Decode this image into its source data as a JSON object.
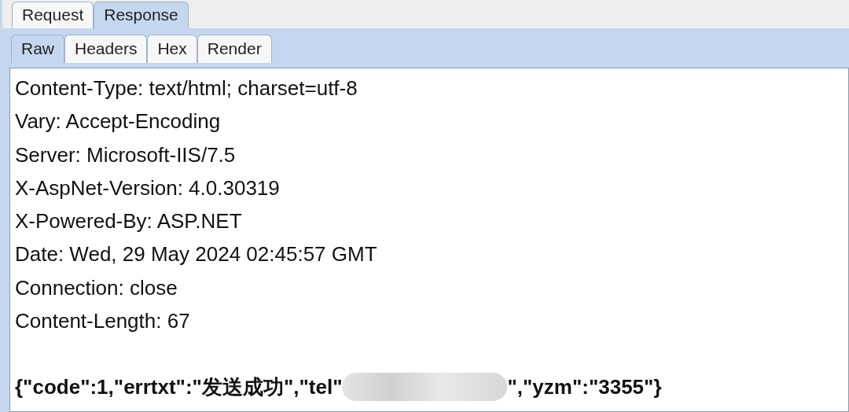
{
  "tabs": [
    {
      "label": "Request",
      "selected": false
    },
    {
      "label": "Response",
      "selected": true
    }
  ],
  "view_tabs": [
    {
      "label": "Raw",
      "selected": true
    },
    {
      "label": "Headers",
      "selected": false
    },
    {
      "label": "Hex",
      "selected": false
    },
    {
      "label": "Render",
      "selected": false
    }
  ],
  "headers": [
    "Content-Type: text/html; charset=utf-8",
    "Vary: Accept-Encoding",
    "Server: Microsoft-IIS/7.5",
    "X-AspNet-Version: 4.0.30319",
    "X-Powered-By: ASP.NET",
    "Date: Wed, 29 May 2024 02:45:57 GMT",
    "Connection: close",
    "Content-Length: 67"
  ],
  "body": {
    "before_redaction": "{\"code\":1,\"errtxt\":\"发送成功\",\"tel\"",
    "after_redaction": "\",\"yzm\":\"3355\"}"
  }
}
